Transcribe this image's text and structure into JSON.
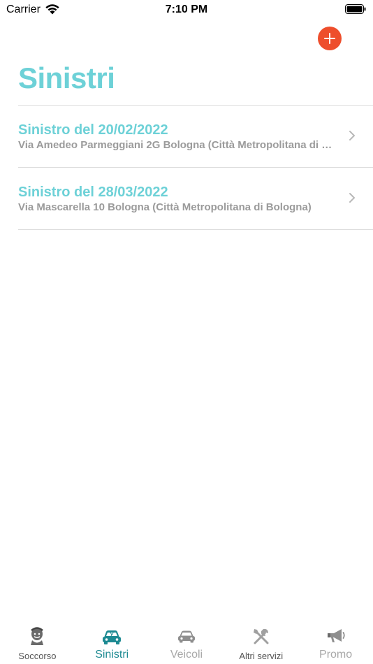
{
  "status_bar": {
    "carrier": "Carrier",
    "time": "7:10 PM"
  },
  "page": {
    "title": "Sinistri",
    "accent_color": "#6dd1d7",
    "add_button_color": "#ee4e2c"
  },
  "claims": [
    {
      "title": "Sinistro del 20/02/2022",
      "address": "Via Amedeo Parmeggiani 2G Bologna (Città Metropolitana di Bologna)"
    },
    {
      "title": "Sinistro del 28/03/2022",
      "address": "Via Mascarella 10 Bologna (Città Metropolitana di Bologna)"
    }
  ],
  "tab_bar": {
    "active_color": "#1d8a92",
    "tabs": [
      {
        "label": "Soccorso",
        "icon": "mechanic-icon"
      },
      {
        "label": "Sinistri",
        "icon": "crashed-car-icon",
        "active": true
      },
      {
        "label": "Veicoli",
        "icon": "car-icon"
      },
      {
        "label": "Altri servizi",
        "icon": "tools-icon"
      },
      {
        "label": "Promo",
        "icon": "megaphone-icon"
      }
    ]
  }
}
